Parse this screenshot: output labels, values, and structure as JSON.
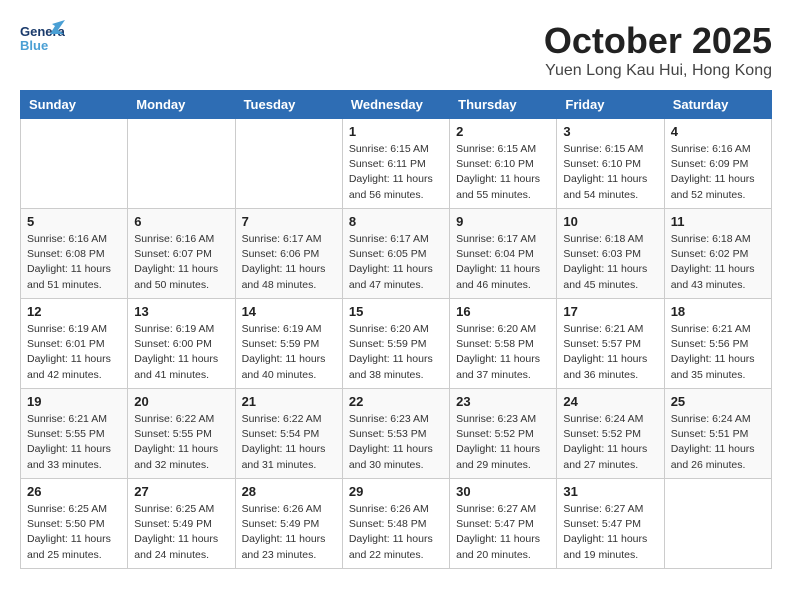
{
  "header": {
    "logo_general": "General",
    "logo_blue": "Blue",
    "month": "October 2025",
    "location": "Yuen Long Kau Hui, Hong Kong"
  },
  "days_of_week": [
    "Sunday",
    "Monday",
    "Tuesday",
    "Wednesday",
    "Thursday",
    "Friday",
    "Saturday"
  ],
  "weeks": [
    [
      {
        "day": "",
        "info": ""
      },
      {
        "day": "",
        "info": ""
      },
      {
        "day": "",
        "info": ""
      },
      {
        "day": "1",
        "info": "Sunrise: 6:15 AM\nSunset: 6:11 PM\nDaylight: 11 hours\nand 56 minutes."
      },
      {
        "day": "2",
        "info": "Sunrise: 6:15 AM\nSunset: 6:10 PM\nDaylight: 11 hours\nand 55 minutes."
      },
      {
        "day": "3",
        "info": "Sunrise: 6:15 AM\nSunset: 6:10 PM\nDaylight: 11 hours\nand 54 minutes."
      },
      {
        "day": "4",
        "info": "Sunrise: 6:16 AM\nSunset: 6:09 PM\nDaylight: 11 hours\nand 52 minutes."
      }
    ],
    [
      {
        "day": "5",
        "info": "Sunrise: 6:16 AM\nSunset: 6:08 PM\nDaylight: 11 hours\nand 51 minutes."
      },
      {
        "day": "6",
        "info": "Sunrise: 6:16 AM\nSunset: 6:07 PM\nDaylight: 11 hours\nand 50 minutes."
      },
      {
        "day": "7",
        "info": "Sunrise: 6:17 AM\nSunset: 6:06 PM\nDaylight: 11 hours\nand 48 minutes."
      },
      {
        "day": "8",
        "info": "Sunrise: 6:17 AM\nSunset: 6:05 PM\nDaylight: 11 hours\nand 47 minutes."
      },
      {
        "day": "9",
        "info": "Sunrise: 6:17 AM\nSunset: 6:04 PM\nDaylight: 11 hours\nand 46 minutes."
      },
      {
        "day": "10",
        "info": "Sunrise: 6:18 AM\nSunset: 6:03 PM\nDaylight: 11 hours\nand 45 minutes."
      },
      {
        "day": "11",
        "info": "Sunrise: 6:18 AM\nSunset: 6:02 PM\nDaylight: 11 hours\nand 43 minutes."
      }
    ],
    [
      {
        "day": "12",
        "info": "Sunrise: 6:19 AM\nSunset: 6:01 PM\nDaylight: 11 hours\nand 42 minutes."
      },
      {
        "day": "13",
        "info": "Sunrise: 6:19 AM\nSunset: 6:00 PM\nDaylight: 11 hours\nand 41 minutes."
      },
      {
        "day": "14",
        "info": "Sunrise: 6:19 AM\nSunset: 5:59 PM\nDaylight: 11 hours\nand 40 minutes."
      },
      {
        "day": "15",
        "info": "Sunrise: 6:20 AM\nSunset: 5:59 PM\nDaylight: 11 hours\nand 38 minutes."
      },
      {
        "day": "16",
        "info": "Sunrise: 6:20 AM\nSunset: 5:58 PM\nDaylight: 11 hours\nand 37 minutes."
      },
      {
        "day": "17",
        "info": "Sunrise: 6:21 AM\nSunset: 5:57 PM\nDaylight: 11 hours\nand 36 minutes."
      },
      {
        "day": "18",
        "info": "Sunrise: 6:21 AM\nSunset: 5:56 PM\nDaylight: 11 hours\nand 35 minutes."
      }
    ],
    [
      {
        "day": "19",
        "info": "Sunrise: 6:21 AM\nSunset: 5:55 PM\nDaylight: 11 hours\nand 33 minutes."
      },
      {
        "day": "20",
        "info": "Sunrise: 6:22 AM\nSunset: 5:55 PM\nDaylight: 11 hours\nand 32 minutes."
      },
      {
        "day": "21",
        "info": "Sunrise: 6:22 AM\nSunset: 5:54 PM\nDaylight: 11 hours\nand 31 minutes."
      },
      {
        "day": "22",
        "info": "Sunrise: 6:23 AM\nSunset: 5:53 PM\nDaylight: 11 hours\nand 30 minutes."
      },
      {
        "day": "23",
        "info": "Sunrise: 6:23 AM\nSunset: 5:52 PM\nDaylight: 11 hours\nand 29 minutes."
      },
      {
        "day": "24",
        "info": "Sunrise: 6:24 AM\nSunset: 5:52 PM\nDaylight: 11 hours\nand 27 minutes."
      },
      {
        "day": "25",
        "info": "Sunrise: 6:24 AM\nSunset: 5:51 PM\nDaylight: 11 hours\nand 26 minutes."
      }
    ],
    [
      {
        "day": "26",
        "info": "Sunrise: 6:25 AM\nSunset: 5:50 PM\nDaylight: 11 hours\nand 25 minutes."
      },
      {
        "day": "27",
        "info": "Sunrise: 6:25 AM\nSunset: 5:49 PM\nDaylight: 11 hours\nand 24 minutes."
      },
      {
        "day": "28",
        "info": "Sunrise: 6:26 AM\nSunset: 5:49 PM\nDaylight: 11 hours\nand 23 minutes."
      },
      {
        "day": "29",
        "info": "Sunrise: 6:26 AM\nSunset: 5:48 PM\nDaylight: 11 hours\nand 22 minutes."
      },
      {
        "day": "30",
        "info": "Sunrise: 6:27 AM\nSunset: 5:47 PM\nDaylight: 11 hours\nand 20 minutes."
      },
      {
        "day": "31",
        "info": "Sunrise: 6:27 AM\nSunset: 5:47 PM\nDaylight: 11 hours\nand 19 minutes."
      },
      {
        "day": "",
        "info": ""
      }
    ]
  ]
}
